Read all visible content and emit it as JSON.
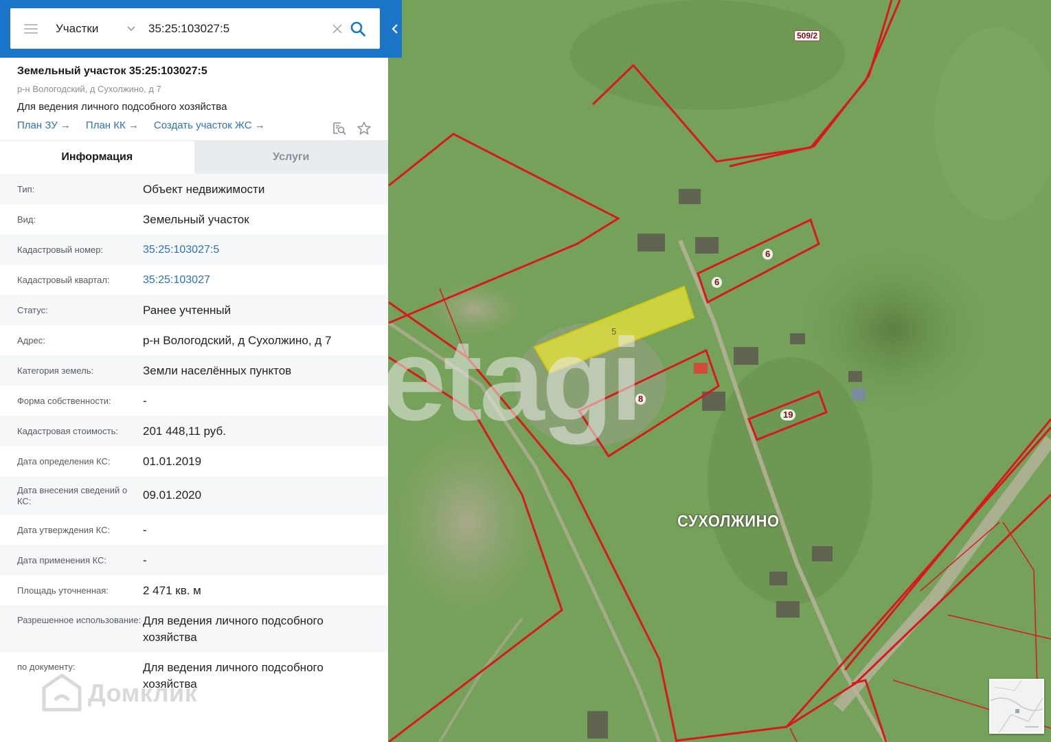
{
  "search": {
    "layer": "Участки",
    "query": "35:25:103027:5"
  },
  "header": {
    "title": "Земельный участок 35:25:103027:5",
    "address": "р-н Вологодский, д Сухолжино, д 7",
    "use": "Для ведения личного подсобного хозяйства",
    "links": [
      "План ЗУ →",
      "План КК →",
      "Создать участок ЖС →"
    ]
  },
  "tabs": [
    "Информация",
    "Услуги"
  ],
  "rows": [
    {
      "k": "Тип:",
      "v": "Объект недвижимости"
    },
    {
      "k": "Вид:",
      "v": "Земельный участок"
    },
    {
      "k": "Кадастровый номер:",
      "v": "35:25:103027:5"
    },
    {
      "k": "Кадастровый квартал:",
      "v": "35:25:103027"
    },
    {
      "k": "Статус:",
      "v": "Ранее учтенный"
    },
    {
      "k": "Адрес:",
      "v": "р-н Вологодский, д Сухолжино, д 7"
    },
    {
      "k": "Категория земель:",
      "v": "Земли населённых пунктов"
    },
    {
      "k": "Форма собственности:",
      "v": "-"
    },
    {
      "k": "Кадастровая стоимость:",
      "v": "201 448,11 руб."
    },
    {
      "k": "Дата определения КС:",
      "v": "01.01.2019"
    },
    {
      "k": "Дата внесения сведений о КС:",
      "v": "09.01.2020"
    },
    {
      "k": "Дата утверждения КС:",
      "v": "-"
    },
    {
      "k": "Дата применения КС:",
      "v": "-"
    },
    {
      "k": "Площадь уточненная:",
      "v": "2 471 кв. м"
    },
    {
      "k": "Разрешенное использование:",
      "v": "Для ведения личного подсобного хозяйства"
    },
    {
      "k": "по документу:",
      "v": "Для ведения личного подсобного хозяйства"
    }
  ],
  "map": {
    "village": "СУХОЛЖИНО",
    "parcel_tag": "509/2",
    "parcels": {
      "p5": "5",
      "p6a": "6",
      "p6b": "6",
      "p8": "8",
      "p19": "19"
    },
    "watermark": "etagi",
    "footer_brand": "Домклик"
  },
  "colors": {
    "accent": "#1b75c9",
    "link": "#2a71c4",
    "parcel_border": "#d7191c",
    "selected_parcel": "#e8e43a"
  }
}
